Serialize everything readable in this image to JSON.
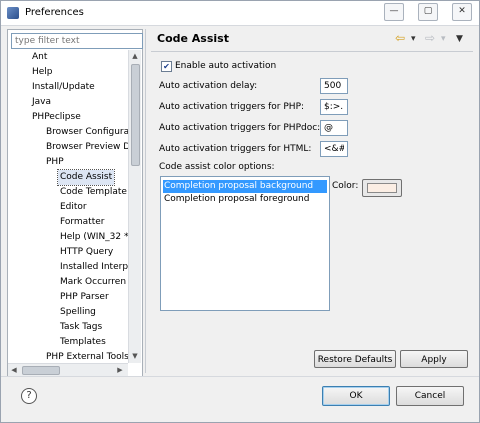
{
  "window": {
    "title": "Preferences",
    "controls": {
      "minimize": "—",
      "maximize": "▢",
      "close": "✕"
    }
  },
  "sidebar": {
    "filter_placeholder": "type filter text",
    "tree": [
      {
        "label": "Ant",
        "level": 0
      },
      {
        "label": "Help",
        "level": 0
      },
      {
        "label": "Install/Update",
        "level": 0
      },
      {
        "label": "Java",
        "level": 0
      },
      {
        "label": "PHPeclipse",
        "level": 0
      },
      {
        "label": "Browser Configura",
        "level": 1
      },
      {
        "label": "Browser Preview D",
        "level": 1
      },
      {
        "label": "PHP",
        "level": 1
      },
      {
        "label": "Code Assist",
        "level": 2,
        "selected": true
      },
      {
        "label": "Code Template",
        "level": 2
      },
      {
        "label": "Editor",
        "level": 2
      },
      {
        "label": "Formatter",
        "level": 2
      },
      {
        "label": "Help (WIN_32 *",
        "level": 2
      },
      {
        "label": "HTTP Query",
        "level": 2
      },
      {
        "label": "Installed Interp",
        "level": 2
      },
      {
        "label": "Mark Occurren",
        "level": 2
      },
      {
        "label": "PHP Parser",
        "level": 2
      },
      {
        "label": "Spelling",
        "level": 2
      },
      {
        "label": "Task Tags",
        "level": 2
      },
      {
        "label": "Templates",
        "level": 2
      },
      {
        "label": "PHP External Tools",
        "level": 1
      }
    ]
  },
  "page": {
    "title": "Code Assist",
    "nav": {
      "back": "⇦",
      "forward": "⇨",
      "menu": "▼"
    },
    "enable_auto_activation": {
      "label": "Enable auto activation",
      "checked": true
    },
    "fields": [
      {
        "label": "Auto activation delay:",
        "value": "500"
      },
      {
        "label": "Auto activation triggers for PHP:",
        "value": "$:>."
      },
      {
        "label": "Auto activation triggers for PHPdoc:",
        "value": "@"
      },
      {
        "label": "Auto activation triggers for HTML:",
        "value": "<&#"
      }
    ],
    "color_options_label": "Code assist color options:",
    "color_options": [
      {
        "label": "Completion proposal background",
        "selected": true
      },
      {
        "label": "Completion proposal foreground",
        "selected": false
      }
    ],
    "color_label": "Color:",
    "color_value": "#fbeee4",
    "restore_defaults": "Restore Defaults",
    "apply": "Apply"
  },
  "footer": {
    "help": "?",
    "ok": "OK",
    "cancel": "Cancel"
  }
}
